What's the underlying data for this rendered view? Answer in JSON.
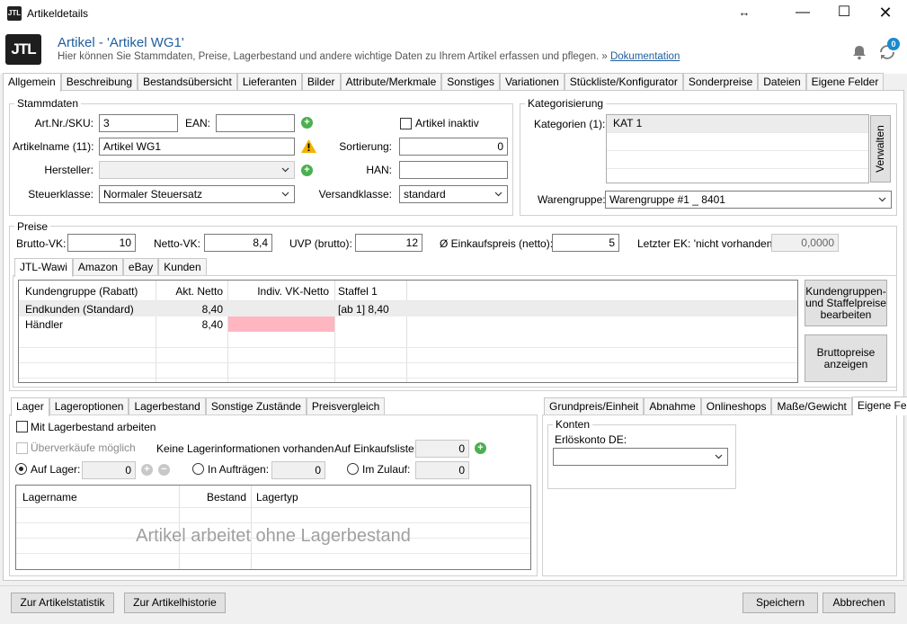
{
  "window": {
    "title": "Artikeldetails",
    "logo_text": "JTL"
  },
  "header": {
    "title": "Artikel - 'Artikel WG1'",
    "subtitle": "Hier können Sie Stammdaten, Preise, Lagerbestand und andere wichtige Daten zu Ihrem Artikel erfassen und pflegen. »",
    "doc_link": "Dokumentation",
    "sync_badge": "0"
  },
  "main_tabs": [
    "Allgemein",
    "Beschreibung",
    "Bestandsübersicht",
    "Lieferanten",
    "Bilder",
    "Attribute/Merkmale",
    "Sonstiges",
    "Variationen",
    "Stückliste/Konfigurator",
    "Sonderpreise",
    "Dateien",
    "Eigene Felder"
  ],
  "stammdaten": {
    "title": "Stammdaten",
    "artnr_label": "Art.Nr./SKU:",
    "artnr_value": "3",
    "ean_label": "EAN:",
    "ean_value": "",
    "inaktiv_label": "Artikel inaktiv",
    "name_label": "Artikelname (11):",
    "name_value": "Artikel WG1",
    "sortierung_label": "Sortierung:",
    "sortierung_value": "0",
    "hersteller_label": "Hersteller:",
    "hersteller_value": "",
    "han_label": "HAN:",
    "han_value": "",
    "steuer_label": "Steuerklasse:",
    "steuer_value": "Normaler Steuersatz",
    "versand_label": "Versandklasse:",
    "versand_value": "standard"
  },
  "kategorisierung": {
    "title": "Kategorisierung",
    "kat_label": "Kategorien (1):",
    "kategorien": [
      "KAT 1"
    ],
    "verwalten": "Verwalten",
    "warengruppe_label": "Warengruppe:",
    "warengruppe_value": "Warengruppe #1 _ 8401"
  },
  "preise": {
    "title": "Preise",
    "brutto_label": "Brutto-VK:",
    "brutto_value": "10",
    "netto_label": "Netto-VK:",
    "netto_value": "8,4",
    "uvp_label": "UVP (brutto):",
    "uvp_value": "12",
    "ek_label": "Ø Einkaufspreis (netto):",
    "ek_value": "5",
    "letzter_ek_label": "Letzter EK: 'nicht vorhanden'",
    "letzter_ek_value": "0,0000",
    "tabs": [
      "JTL-Wawi",
      "Amazon",
      "eBay",
      "Kunden"
    ],
    "columns": [
      "Kundengruppe (Rabatt)",
      "Akt. Netto",
      "Indiv. VK-Netto",
      "Staffel 1"
    ],
    "rows": [
      {
        "gruppe": "Endkunden (Standard)",
        "netto": "8,40",
        "indiv": "",
        "staffel": "[ab 1] 8,40"
      },
      {
        "gruppe": "Händler",
        "netto": "8,40",
        "indiv": "",
        "staffel": ""
      }
    ],
    "btn_kundengruppen": "Kundengruppen- und Staffelpreise bearbeiten",
    "btn_brutto": "Bruttopreise anzeigen"
  },
  "lager": {
    "tabs": [
      "Lager",
      "Lageroptionen",
      "Lagerbestand",
      "Sonstige Zustände",
      "Preisvergleich"
    ],
    "mit_lager_label": "Mit Lagerbestand arbeiten",
    "ueberverkauf_label": "Überverkäufe möglich",
    "keine_info": "Keine Lagerinformationen vorhanden",
    "einkaufsliste_label": "Auf Einkaufsliste:",
    "einkaufsliste_value": "0",
    "auf_lager_label": "Auf Lager:",
    "auf_lager_value": "0",
    "in_auftraegen_label": "In Aufträgen:",
    "in_auftraegen_value": "0",
    "im_zulauf_label": "Im Zulauf:",
    "im_zulauf_value": "0",
    "columns": [
      "Lagername",
      "Bestand",
      "Lagertyp"
    ],
    "empty_text": "Artikel arbeitet ohne Lagerbestand"
  },
  "right_panel": {
    "tabs": [
      "Grundpreis/Einheit",
      "Abnahme",
      "Onlineshops",
      "Maße/Gewicht",
      "Eigene Felder"
    ],
    "konten_title": "Konten",
    "erloeskonto_label": "Erlöskonto DE:",
    "erloeskonto_value": ""
  },
  "footer": {
    "statistik": "Zur Artikelstatistik",
    "historie": "Zur Artikelhistorie",
    "speichern": "Speichern",
    "abbrechen": "Abbrechen"
  },
  "colors": {
    "accent": "#1f5e9e",
    "pink": "#ffb6c1",
    "plus_green": "#4caf50",
    "warning": "#f2b300"
  }
}
